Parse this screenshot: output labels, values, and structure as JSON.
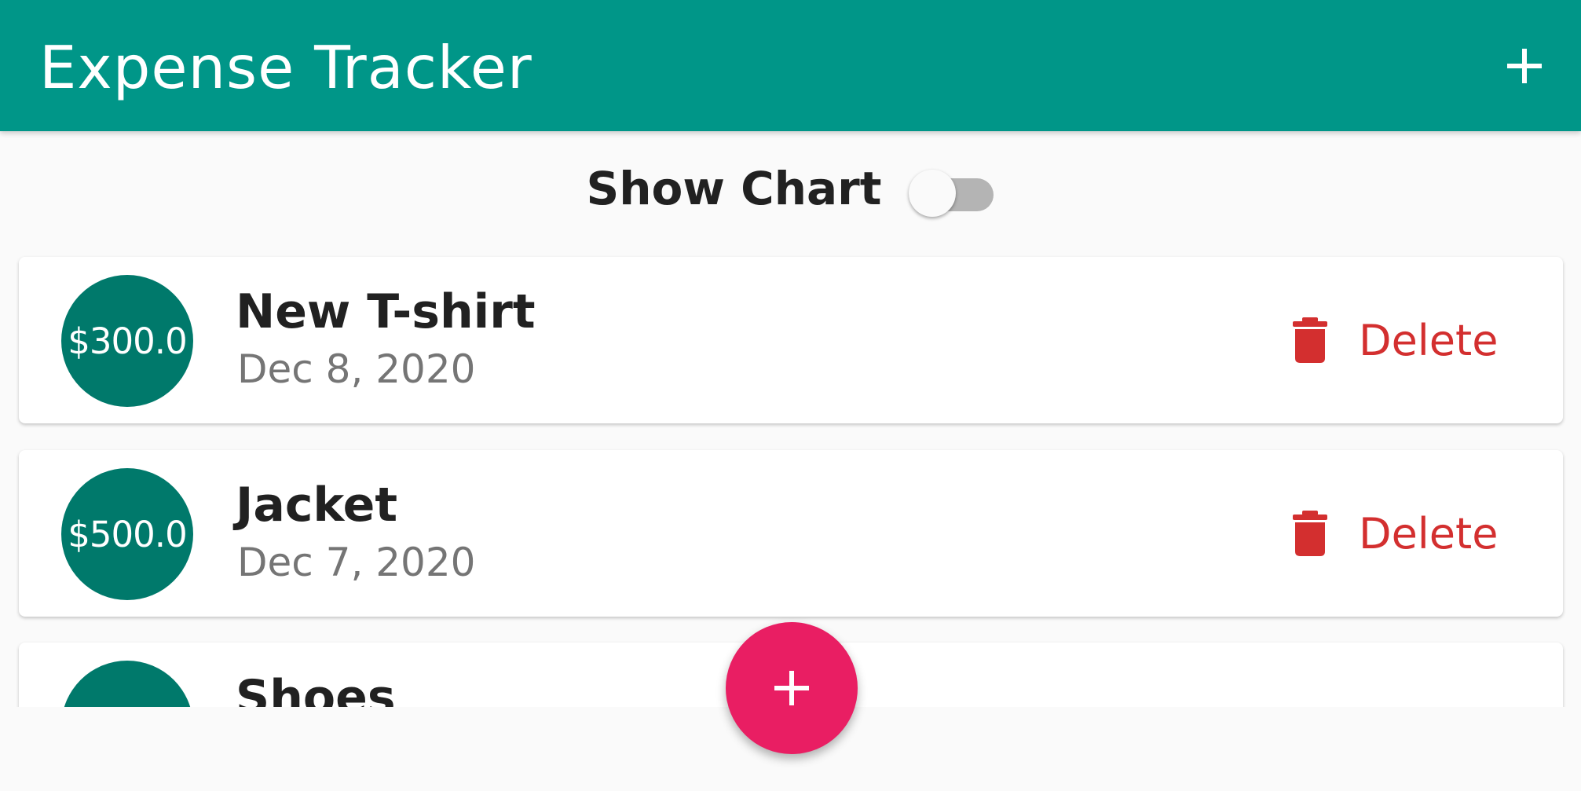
{
  "app_bar": {
    "title": "Expense Tracker",
    "add_icon": "plus-icon"
  },
  "toggle": {
    "label": "Show Chart",
    "on": false
  },
  "transactions": [
    {
      "amount": "$300.0",
      "title": "New T-shirt",
      "date": "Dec 8, 2020",
      "delete_label": "Delete",
      "delete_icon": "trash-icon"
    },
    {
      "amount": "$500.0",
      "title": "Jacket",
      "date": "Dec 7, 2020",
      "delete_label": "Delete",
      "delete_icon": "trash-icon"
    },
    {
      "title": "Shoes"
    }
  ],
  "fab": {
    "icon": "plus-icon"
  },
  "colors": {
    "primary": "#009688",
    "avatar": "#00796b",
    "delete": "#d32f2f",
    "fab": "#e91e63",
    "background": "#fafafa"
  }
}
